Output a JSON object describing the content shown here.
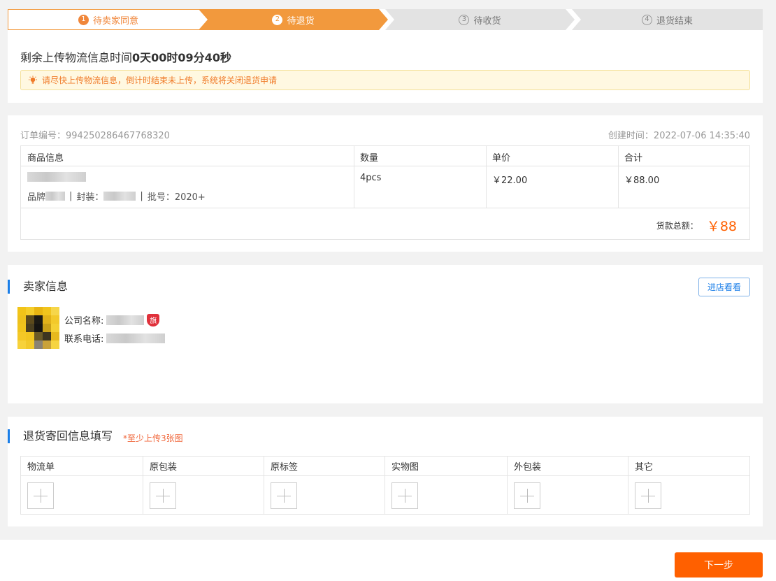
{
  "steps": [
    {
      "num": "1",
      "label": "待卖家同意"
    },
    {
      "num": "2",
      "label": "待退货"
    },
    {
      "num": "3",
      "label": "待收货"
    },
    {
      "num": "4",
      "label": "退货结束"
    }
  ],
  "countdown": {
    "prefix": "剩余上传物流信息时间",
    "time": "0天00时09分40秒"
  },
  "notice": "请尽快上传物流信息，倒计时结束未上传，系统将关闭退货申请",
  "order": {
    "number_label": "订单编号：",
    "number": "994250286467768320",
    "created_label": "创建时间：",
    "created": "2022-07-06 14:35:40",
    "headers": [
      "商品信息",
      "数量",
      "单价",
      "合计"
    ],
    "item": {
      "brand_label": "品牌",
      "package_label": "封装：",
      "batch_label": "批号：",
      "batch": "2020+",
      "separator": "|",
      "qty": "4pcs",
      "price": "￥22.00",
      "subtotal": "￥88.00"
    },
    "total_label": "货款总额：",
    "total": "￥88"
  },
  "seller": {
    "title": "卖家信息",
    "shop_button": "进店看看",
    "company_label": "公司名称:",
    "phone_label": "联系电话:",
    "flag": "旗"
  },
  "upload": {
    "title": "退货寄回信息填写",
    "hint": "*至少上传3张图",
    "columns": [
      "物流单",
      "原包装",
      "原标签",
      "实物图",
      "外包装",
      "其它"
    ]
  },
  "next_button": "下一步",
  "colors": {
    "accent": "#f2993d",
    "brand_orange": "#ff6000",
    "link_blue": "#1a7ee8",
    "price_red": "#f0663a"
  }
}
